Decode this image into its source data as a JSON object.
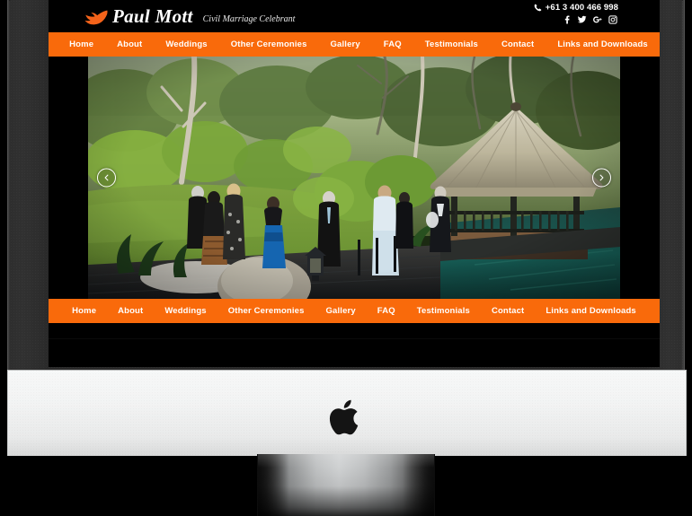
{
  "device": {
    "type": "imac-desktop-monitor",
    "brand_mark": "apple-logo"
  },
  "site": {
    "header": {
      "brand_name": "Paul Mott",
      "brand_tagline": "Civil Marriage Celebrant",
      "logo_icon": "bird-icon",
      "phone": "+61 3 400 466 998",
      "phone_icon": "phone-icon",
      "social": [
        {
          "name": "facebook",
          "icon": "facebook-icon",
          "glyph": "f"
        },
        {
          "name": "twitter",
          "icon": "twitter-icon",
          "glyph": "t"
        },
        {
          "name": "google-plus",
          "icon": "google-plus-icon",
          "glyph": "g+"
        },
        {
          "name": "instagram",
          "icon": "instagram-icon",
          "glyph": "ig"
        }
      ]
    },
    "nav": {
      "items": [
        {
          "label": "Home",
          "key": "home"
        },
        {
          "label": "About",
          "key": "about"
        },
        {
          "label": "Weddings",
          "key": "weddings"
        },
        {
          "label": "Other Ceremonies",
          "key": "other-ceremonies"
        },
        {
          "label": "Gallery",
          "key": "gallery"
        },
        {
          "label": "FAQ",
          "key": "faq"
        },
        {
          "label": "Testimonials",
          "key": "testimonials"
        },
        {
          "label": "Contact",
          "key": "contact"
        },
        {
          "label": "Links and Downloads",
          "key": "links-and-downloads"
        }
      ]
    },
    "hero": {
      "alt": "Outdoor garden wedding ceremony beside a thatched-roof gazebo over a pond",
      "prev_label": "‹",
      "next_label": "›",
      "prev_icon": "chevron-left-icon",
      "next_icon": "chevron-right-icon"
    },
    "colors": {
      "accent_orange": "#f96a0b",
      "header_black": "#000000",
      "nav_text": "#ffffff",
      "bezel_gray": "#2a2a2a",
      "chin_silver": "#f2f3f3"
    }
  }
}
